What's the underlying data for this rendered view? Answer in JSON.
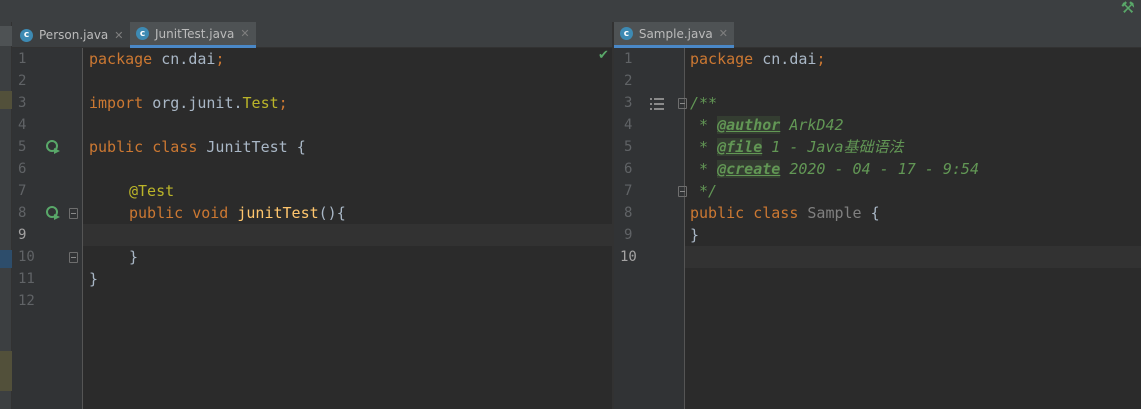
{
  "left_editor": {
    "tabs": [
      {
        "label": "Person.java",
        "icon": "c"
      },
      {
        "label": "JunitTest.java",
        "icon": "c"
      }
    ],
    "line_numbers": [
      "1",
      "2",
      "3",
      "4",
      "5",
      "6",
      "7",
      "8",
      "9",
      "10",
      "11",
      "12"
    ],
    "code": {
      "l1_kw": "package",
      "l1_rest": " cn.dai",
      "l1_semi": ";",
      "l3_kw": "import",
      "l3_pkg": " org.junit.",
      "l3_cls": "Test",
      "l3_semi": ";",
      "l5_kw": "public class",
      "l5_name": " JunitTest {",
      "l7_ann": "@Test",
      "l8_kw": "public void",
      "l8_fn": " junitTest",
      "l8_rest": "(){",
      "l10": "}",
      "l11": "}"
    }
  },
  "right_editor": {
    "tabs": [
      {
        "label": "Sample.java",
        "icon": "c"
      }
    ],
    "line_numbers": [
      "1",
      "2",
      "3",
      "4",
      "5",
      "6",
      "7",
      "8",
      "9",
      "10"
    ],
    "code": {
      "l1_kw": "package",
      "l1_rest": " cn.dai",
      "l1_semi": ";",
      "l3": "/**",
      "l4_star": " * ",
      "l4_tag": "@author",
      "l4_val": " ArkD42",
      "l5_star": " * ",
      "l5_tag": "@file",
      "l5_val": " 1 - Java基础语法",
      "l6_star": " * ",
      "l6_tag": "@create",
      "l6_val": " 2020 - 04 - 17 - 9:54",
      "l7": " */",
      "l8_kw": "public class",
      "l8_name": " Sample",
      "l8_brace": " {",
      "l9": "}"
    }
  },
  "colors": {
    "keyword": "#cc7832",
    "annotation": "#bbb529",
    "function": "#ffc66d",
    "doc_comment": "#629755",
    "text": "#a9b7c6",
    "tab_accent": "#4a88c7"
  }
}
